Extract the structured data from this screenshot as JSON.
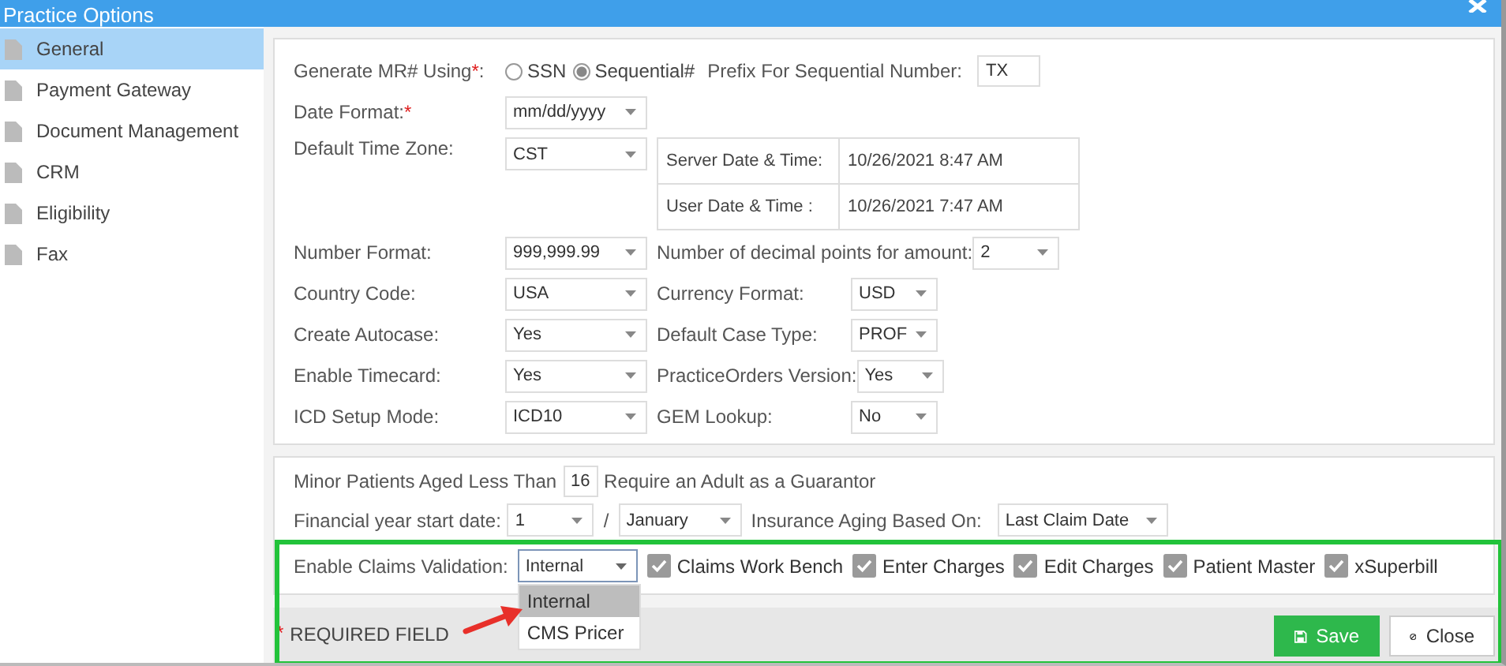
{
  "window": {
    "title": "Practice Options"
  },
  "sidebar": {
    "items": [
      {
        "label": "General",
        "selected": true
      },
      {
        "label": "Payment Gateway",
        "selected": false
      },
      {
        "label": "Document Management",
        "selected": false
      },
      {
        "label": "CRM",
        "selected": false
      },
      {
        "label": "Eligibility",
        "selected": false
      },
      {
        "label": "Fax",
        "selected": false
      }
    ]
  },
  "mr_generation": {
    "label": "Generate MR# Using",
    "required_mark": "*",
    "label_suffix": ":",
    "options": [
      {
        "label": "SSN",
        "selected": false
      },
      {
        "label": "Sequential#",
        "selected": true
      }
    ],
    "prefix_label": "Prefix For Sequential Number:",
    "prefix_value": "TX"
  },
  "date_format": {
    "label": "Date Format:",
    "required_mark": "*",
    "value": "mm/dd/yyyy"
  },
  "time_zone": {
    "label": "Default Time Zone:",
    "value": "CST"
  },
  "datetime_table": [
    {
      "label": "Server Date & Time:",
      "value": "10/26/2021 8:47 AM"
    },
    {
      "label": "User Date & Time :",
      "value": "10/26/2021 7:47 AM"
    }
  ],
  "settings": [
    {
      "label": "Number Format:",
      "value": "999,999.99",
      "right_label": "Number of decimal points for amount:",
      "right_value": "2"
    },
    {
      "label": "Country Code:",
      "value": "USA",
      "right_label": "Currency Format:",
      "right_value": "USD"
    },
    {
      "label": "Create Autocase:",
      "value": "Yes",
      "right_label": "Default Case Type:",
      "right_value": "PROF"
    },
    {
      "label": "Enable Timecard:",
      "value": "Yes",
      "right_label": "PracticeOrders Version:",
      "right_value": "Yes"
    },
    {
      "label": "ICD Setup Mode:",
      "value": "ICD10",
      "right_label": "GEM Lookup:",
      "right_value": "No"
    }
  ],
  "guarantor": {
    "prefix": "Minor Patients Aged Less Than",
    "value": "16",
    "suffix": "Require an Adult as a Guarantor"
  },
  "financial_year": {
    "label": "Financial year start date:",
    "day": "1",
    "separator": "/",
    "month": "January",
    "aging_label": "Insurance Aging Based On:",
    "aging_value": "Last Claim Date"
  },
  "claims_validation": {
    "label": "Enable Claims Validation:",
    "value": "Internal",
    "dropdown_options": [
      {
        "label": "Internal",
        "selected": true
      },
      {
        "label": "CMS Pricer",
        "selected": false
      }
    ],
    "checkboxes": [
      {
        "label": "Claims Work Bench",
        "checked": true
      },
      {
        "label": "Enter Charges",
        "checked": true
      },
      {
        "label": "Edit Charges",
        "checked": true
      },
      {
        "label": "Patient Master",
        "checked": true
      },
      {
        "label": "xSuperbill",
        "checked": true
      }
    ]
  },
  "footer": {
    "required_mark": "*",
    "required_label": "REQUIRED FIELD",
    "buttons": [
      {
        "label": "Save",
        "kind": "primary"
      },
      {
        "label": "Close",
        "kind": "secondary"
      }
    ]
  }
}
